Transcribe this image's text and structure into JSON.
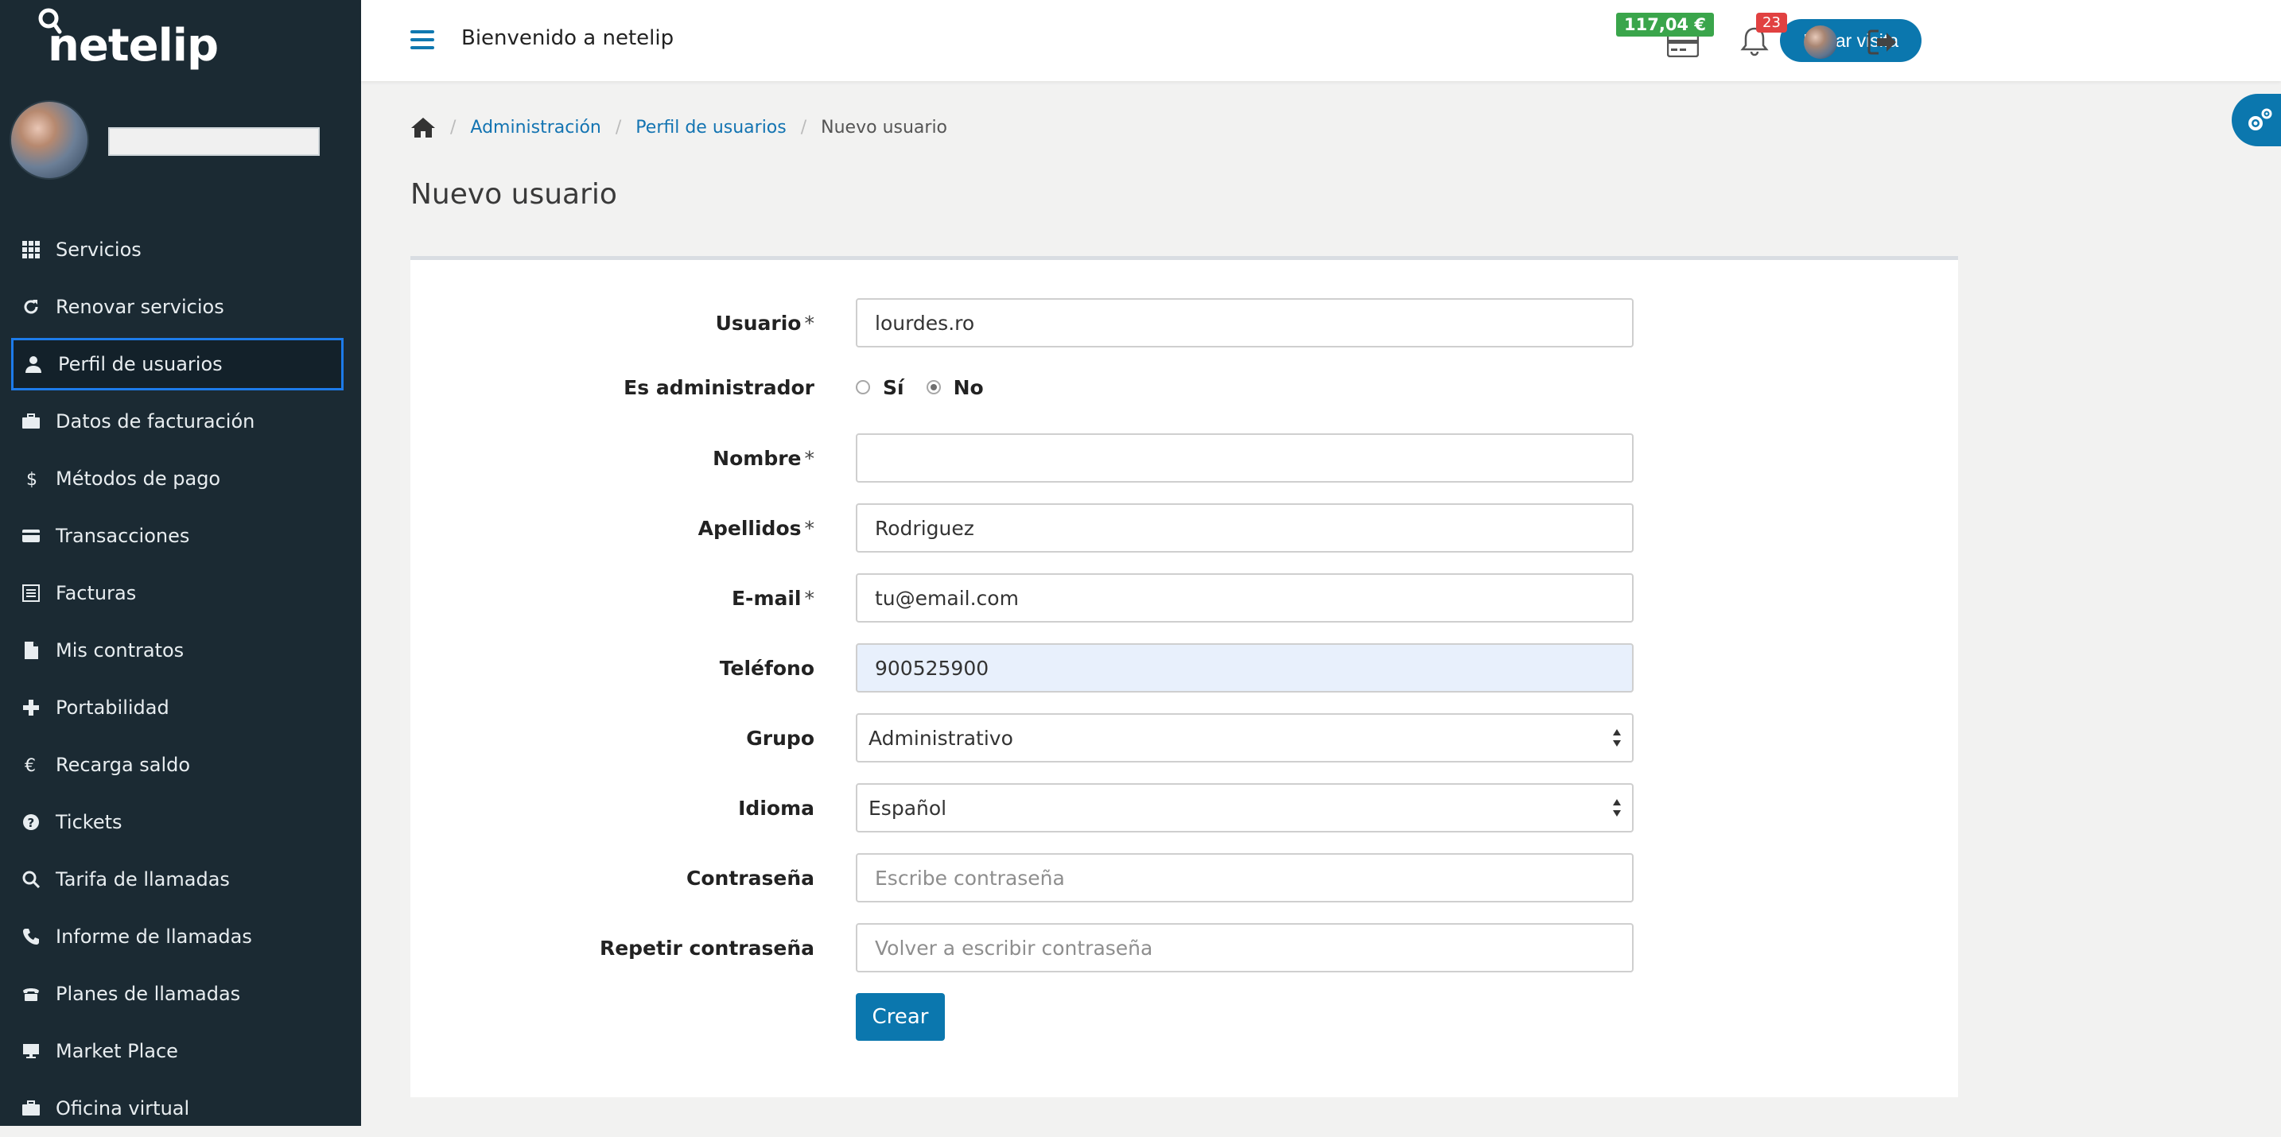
{
  "app": {
    "logo_text": "netelip"
  },
  "sidebar": {
    "items": [
      {
        "label": "Servicios",
        "icon": "grid-icon"
      },
      {
        "label": "Renovar servicios",
        "icon": "refresh-icon"
      },
      {
        "label": "Perfil de usuarios",
        "icon": "user-icon",
        "active": true
      },
      {
        "label": "Datos de facturación",
        "icon": "briefcase-icon"
      },
      {
        "label": "Métodos de pago",
        "icon": "dollar-icon"
      },
      {
        "label": "Transacciones",
        "icon": "credit-card-icon"
      },
      {
        "label": "Facturas",
        "icon": "list-icon"
      },
      {
        "label": "Mis contratos",
        "icon": "file-icon"
      },
      {
        "label": "Portabilidad",
        "icon": "plus-icon"
      },
      {
        "label": "Recarga saldo",
        "icon": "euro-icon"
      },
      {
        "label": "Tickets",
        "icon": "question-icon"
      },
      {
        "label": "Tarifa de llamadas",
        "icon": "search-icon"
      },
      {
        "label": "Informe de llamadas",
        "icon": "phone-icon"
      },
      {
        "label": "Planes de llamadas",
        "icon": "deskphone-icon"
      },
      {
        "label": "Market Place",
        "icon": "monitor-icon"
      },
      {
        "label": "Oficina virtual",
        "icon": "suitcase-icon"
      }
    ]
  },
  "topbar": {
    "welcome": "Bienvenido a netelip",
    "visit_button": "Iniciar visita",
    "balance": "117,04 €",
    "notifications": "23"
  },
  "breadcrumb": {
    "items": [
      "Administración",
      "Perfil de usuarios"
    ],
    "current": "Nuevo usuario"
  },
  "page": {
    "title": "Nuevo usuario"
  },
  "form": {
    "usuario": {
      "label": "Usuario",
      "required": "*",
      "value": "lourdes.ro"
    },
    "admin": {
      "label": "Es administrador",
      "yes": "Sí",
      "no": "No",
      "selected": "no"
    },
    "nombre": {
      "label": "Nombre",
      "required": "*",
      "value": ""
    },
    "apellidos": {
      "label": "Apellidos",
      "required": "*",
      "value": "Rodriguez"
    },
    "email": {
      "label": "E-mail",
      "required": "*",
      "value": "tu@email.com"
    },
    "telefono": {
      "label": "Teléfono",
      "value": "900525900"
    },
    "grupo": {
      "label": "Grupo",
      "value": "Administrativo"
    },
    "idioma": {
      "label": "Idioma",
      "value": "Español"
    },
    "password": {
      "label": "Contraseña",
      "placeholder": "Escribe contraseña"
    },
    "password_repeat": {
      "label": "Repetir contraseña",
      "placeholder": "Volver a escribir contraseña"
    },
    "submit": "Crear"
  },
  "colors": {
    "sidebar_bg": "#1b2a33",
    "accent": "#0b77ae",
    "balance_badge": "#3aa54b",
    "notification_badge": "#e14141",
    "active_outline": "#1d7bea"
  }
}
